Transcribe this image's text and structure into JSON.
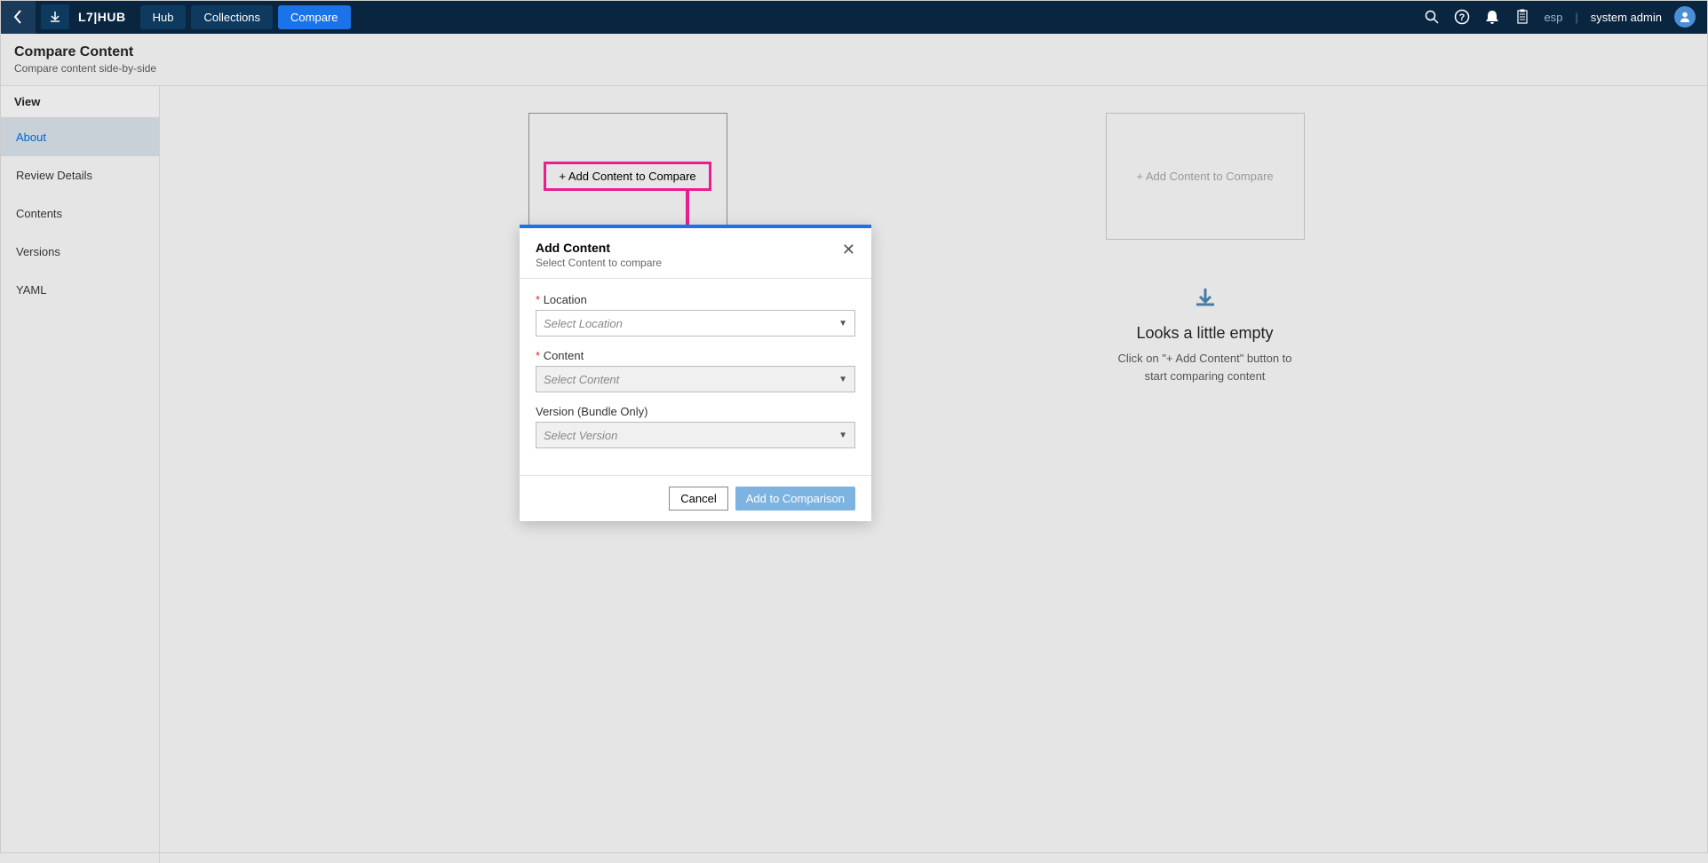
{
  "topbar": {
    "app_name": "L7|HUB",
    "nav": [
      "Hub",
      "Collections",
      "Compare"
    ],
    "esp": "esp",
    "username": "system admin"
  },
  "header": {
    "title": "Compare Content",
    "subtitle": "Compare content side-by-side"
  },
  "sidebar": {
    "heading": "View",
    "items": [
      "About",
      "Review Details",
      "Contents",
      "Versions",
      "YAML"
    ]
  },
  "compare": {
    "add_label_left": "+ Add Content to Compare",
    "add_label_right": "+ Add Content to Compare",
    "empty_title": "Looks a little empty",
    "empty_text": "Click on \"+ Add Content\" button to start comparing content"
  },
  "modal": {
    "title": "Add Content",
    "subtitle": "Select Content to compare",
    "location_label": "Location",
    "location_placeholder": "Select Location",
    "content_label": "Content",
    "content_placeholder": "Select Content",
    "version_label": "Version (Bundle Only)",
    "version_placeholder": "Select Version",
    "cancel": "Cancel",
    "submit": "Add to Comparison"
  }
}
